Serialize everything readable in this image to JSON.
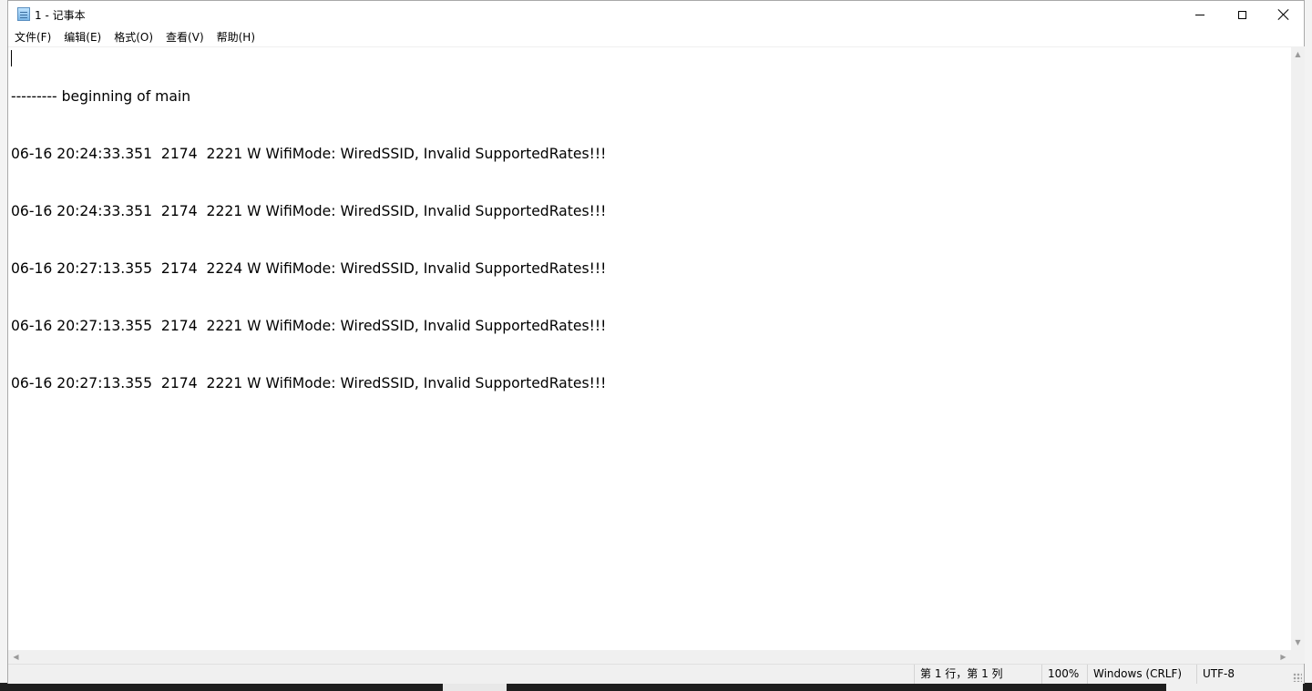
{
  "window": {
    "title": "1 - 记事本"
  },
  "window_controls": {
    "minimize": "minimize",
    "maximize": "maximize",
    "close": "close"
  },
  "menu": [
    {
      "label": "文件(F)"
    },
    {
      "label": "编辑(E)"
    },
    {
      "label": "格式(O)"
    },
    {
      "label": "查看(V)"
    },
    {
      "label": "帮助(H)"
    }
  ],
  "editor": {
    "lines": [
      "--------- beginning of main",
      "06-16 20:24:33.351  2174  2221 W WifiMode: WiredSSID, Invalid SupportedRates!!!",
      "06-16 20:24:33.351  2174  2221 W WifiMode: WiredSSID, Invalid SupportedRates!!!",
      "06-16 20:27:13.355  2174  2224 W WifiMode: WiredSSID, Invalid SupportedRates!!!",
      "06-16 20:27:13.355  2174  2221 W WifiMode: WiredSSID, Invalid SupportedRates!!!",
      "06-16 20:27:13.355  2174  2221 W WifiMode: WiredSSID, Invalid SupportedRates!!!"
    ]
  },
  "status": {
    "position": "第 1 行，第 1 列",
    "zoom": "100%",
    "line_ending": "Windows (CRLF)",
    "encoding": "UTF-8"
  },
  "icons": {
    "app": "notepad-icon"
  }
}
